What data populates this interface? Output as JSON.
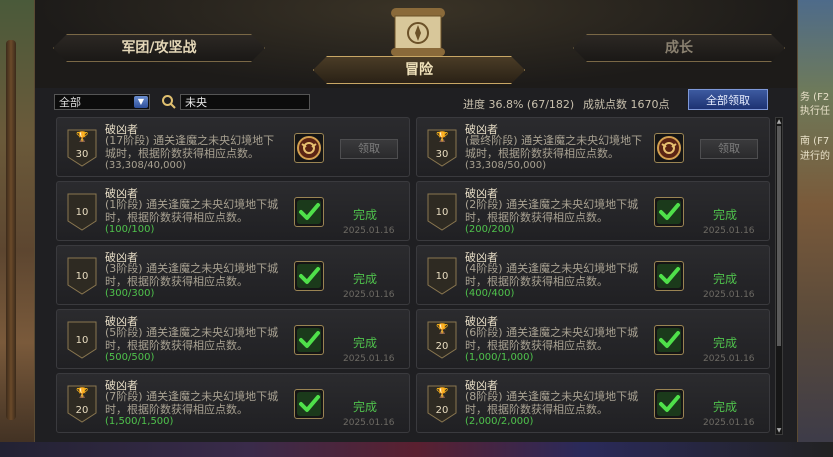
{
  "tabs": {
    "left": "军团/攻坚战",
    "right": "成长",
    "center": "冒险"
  },
  "filter": {
    "selected": "全部",
    "search_value": "未央"
  },
  "stats": {
    "progress": "进度 36.8% (67/182)",
    "points": "成就点数 1670点"
  },
  "claim_all_label": "全部领取",
  "side": {
    "line1": "务 (F2",
    "line2": "执行任",
    "line3": "南 (F7",
    "line4": "进行的"
  },
  "colors": {
    "complete": "#4fc24c",
    "accent_blue": "#3d5aa0",
    "gold_border": "#c9a765"
  },
  "achievements": [
    {
      "title": "破凶者",
      "desc": "(17阶段) 通关逢魔之未央幻境地下城时，根据阶数获得相应点数。",
      "progress": "(33,308/40,000)",
      "points": "30",
      "trophy": true,
      "status": "claim",
      "button": "领取",
      "date": "",
      "reward_icon": "demon-emblem-icon"
    },
    {
      "title": "破凶者",
      "desc": "(最终阶段) 通关逢魔之未央幻境地下城时，根据阶数获得相应点数。",
      "progress": "(33,308/50,000)",
      "points": "30",
      "trophy": true,
      "status": "claim",
      "button": "领取",
      "date": "",
      "reward_icon": "demon-emblem-icon"
    },
    {
      "title": "破凶者",
      "desc": "(1阶段) 通关逢魔之未央幻境地下城时，根据阶数获得相应点数。",
      "progress": "(100/100)",
      "points": "10",
      "trophy": false,
      "status": "done",
      "button": "完成",
      "date": "2025.01.16",
      "reward_icon": "check-icon"
    },
    {
      "title": "破凶者",
      "desc": "(2阶段) 通关逢魔之未央幻境地下城时，根据阶数获得相应点数。",
      "progress": "(200/200)",
      "points": "10",
      "trophy": false,
      "status": "done",
      "button": "完成",
      "date": "2025.01.16",
      "reward_icon": "check-icon"
    },
    {
      "title": "破凶者",
      "desc": "(3阶段) 通关逢魔之未央幻境地下城时，根据阶数获得相应点数。",
      "progress": "(300/300)",
      "points": "10",
      "trophy": false,
      "status": "done",
      "button": "完成",
      "date": "2025.01.16",
      "reward_icon": "check-icon"
    },
    {
      "title": "破凶者",
      "desc": "(4阶段) 通关逢魔之未央幻境地下城时，根据阶数获得相应点数。",
      "progress": "(400/400)",
      "points": "10",
      "trophy": false,
      "status": "done",
      "button": "完成",
      "date": "2025.01.16",
      "reward_icon": "check-icon"
    },
    {
      "title": "破凶者",
      "desc": "(5阶段) 通关逢魔之未央幻境地下城时，根据阶数获得相应点数。",
      "progress": "(500/500)",
      "points": "10",
      "trophy": false,
      "status": "done",
      "button": "完成",
      "date": "2025.01.16",
      "reward_icon": "check-icon"
    },
    {
      "title": "破凶者",
      "desc": "(6阶段) 通关逢魔之未央幻境地下城时，根据阶数获得相应点数。",
      "progress": "(1,000/1,000)",
      "points": "20",
      "trophy": true,
      "status": "done",
      "button": "完成",
      "date": "2025.01.16",
      "reward_icon": "check-icon"
    },
    {
      "title": "破凶者",
      "desc": "(7阶段) 通关逢魔之未央幻境地下城时，根据阶数获得相应点数。",
      "progress": "(1,500/1,500)",
      "points": "20",
      "trophy": true,
      "status": "done",
      "button": "完成",
      "date": "2025.01.16",
      "reward_icon": "check-icon"
    },
    {
      "title": "破凶者",
      "desc": "(8阶段) 通关逢魔之未央幻境地下城时，根据阶数获得相应点数。",
      "progress": "(2,000/2,000)",
      "points": "20",
      "trophy": true,
      "status": "done",
      "button": "完成",
      "date": "2025.01.16",
      "reward_icon": "check-icon"
    }
  ]
}
